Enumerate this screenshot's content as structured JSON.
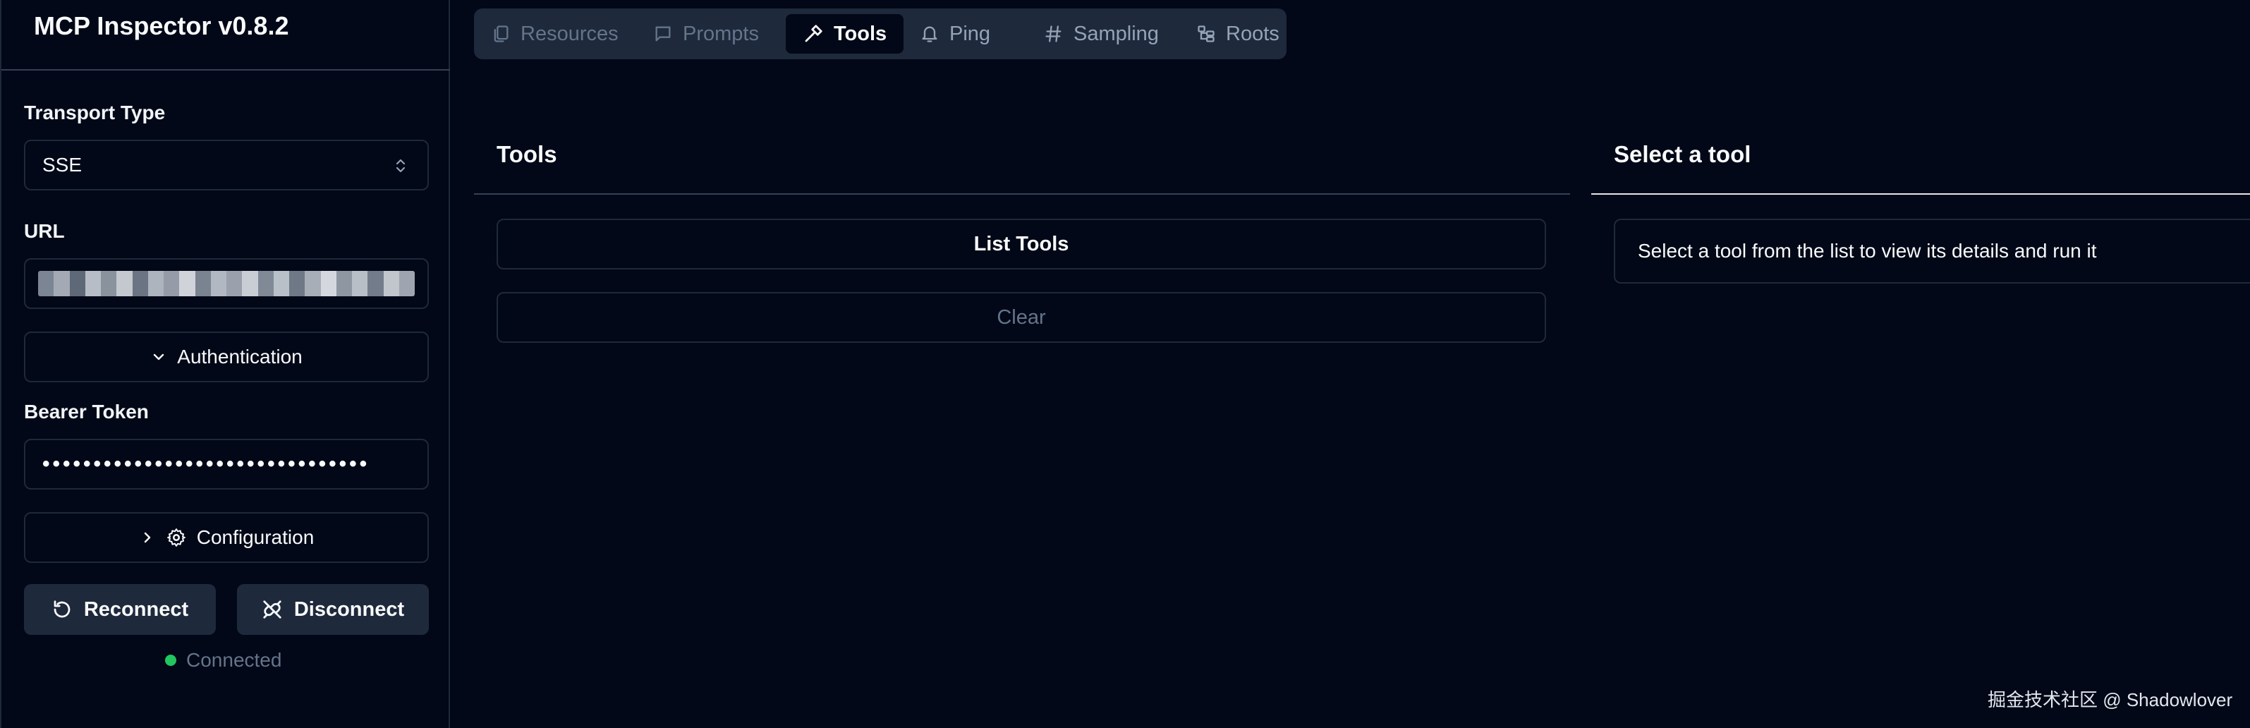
{
  "app": {
    "title": "MCP Inspector v0.8.2"
  },
  "sidebar": {
    "transport_label": "Transport Type",
    "transport_value": "SSE",
    "url_label": "URL",
    "auth_label": "Authentication",
    "bearer_label": "Bearer Token",
    "bearer_value": "••••••••••••••••••••••••••••••••",
    "config_label": "Configuration",
    "reconnect_label": "Reconnect",
    "disconnect_label": "Disconnect",
    "status_text": "Connected",
    "status_color": "#22c55e"
  },
  "tabs": [
    {
      "label": "Resources",
      "icon": "files-icon",
      "active": false
    },
    {
      "label": "Prompts",
      "icon": "message-icon",
      "active": false
    },
    {
      "label": "Tools",
      "icon": "hammer-icon",
      "active": true
    },
    {
      "label": "Ping",
      "icon": "bell-icon",
      "active": false
    },
    {
      "label": "Sampling",
      "icon": "hash-icon",
      "active": false
    },
    {
      "label": "Roots",
      "icon": "folder-tree-icon",
      "active": false
    }
  ],
  "tools_panel": {
    "title": "Tools",
    "list_button": "List Tools",
    "clear_button": "Clear"
  },
  "detail_panel": {
    "title": "Select a tool",
    "message": "Select a tool from the list to view its details and run it"
  },
  "watermark": "掘金技术社区 @ Shadowlover",
  "colors": {
    "background": "#020817",
    "border": "#1e293b",
    "muted": "#64748b"
  }
}
